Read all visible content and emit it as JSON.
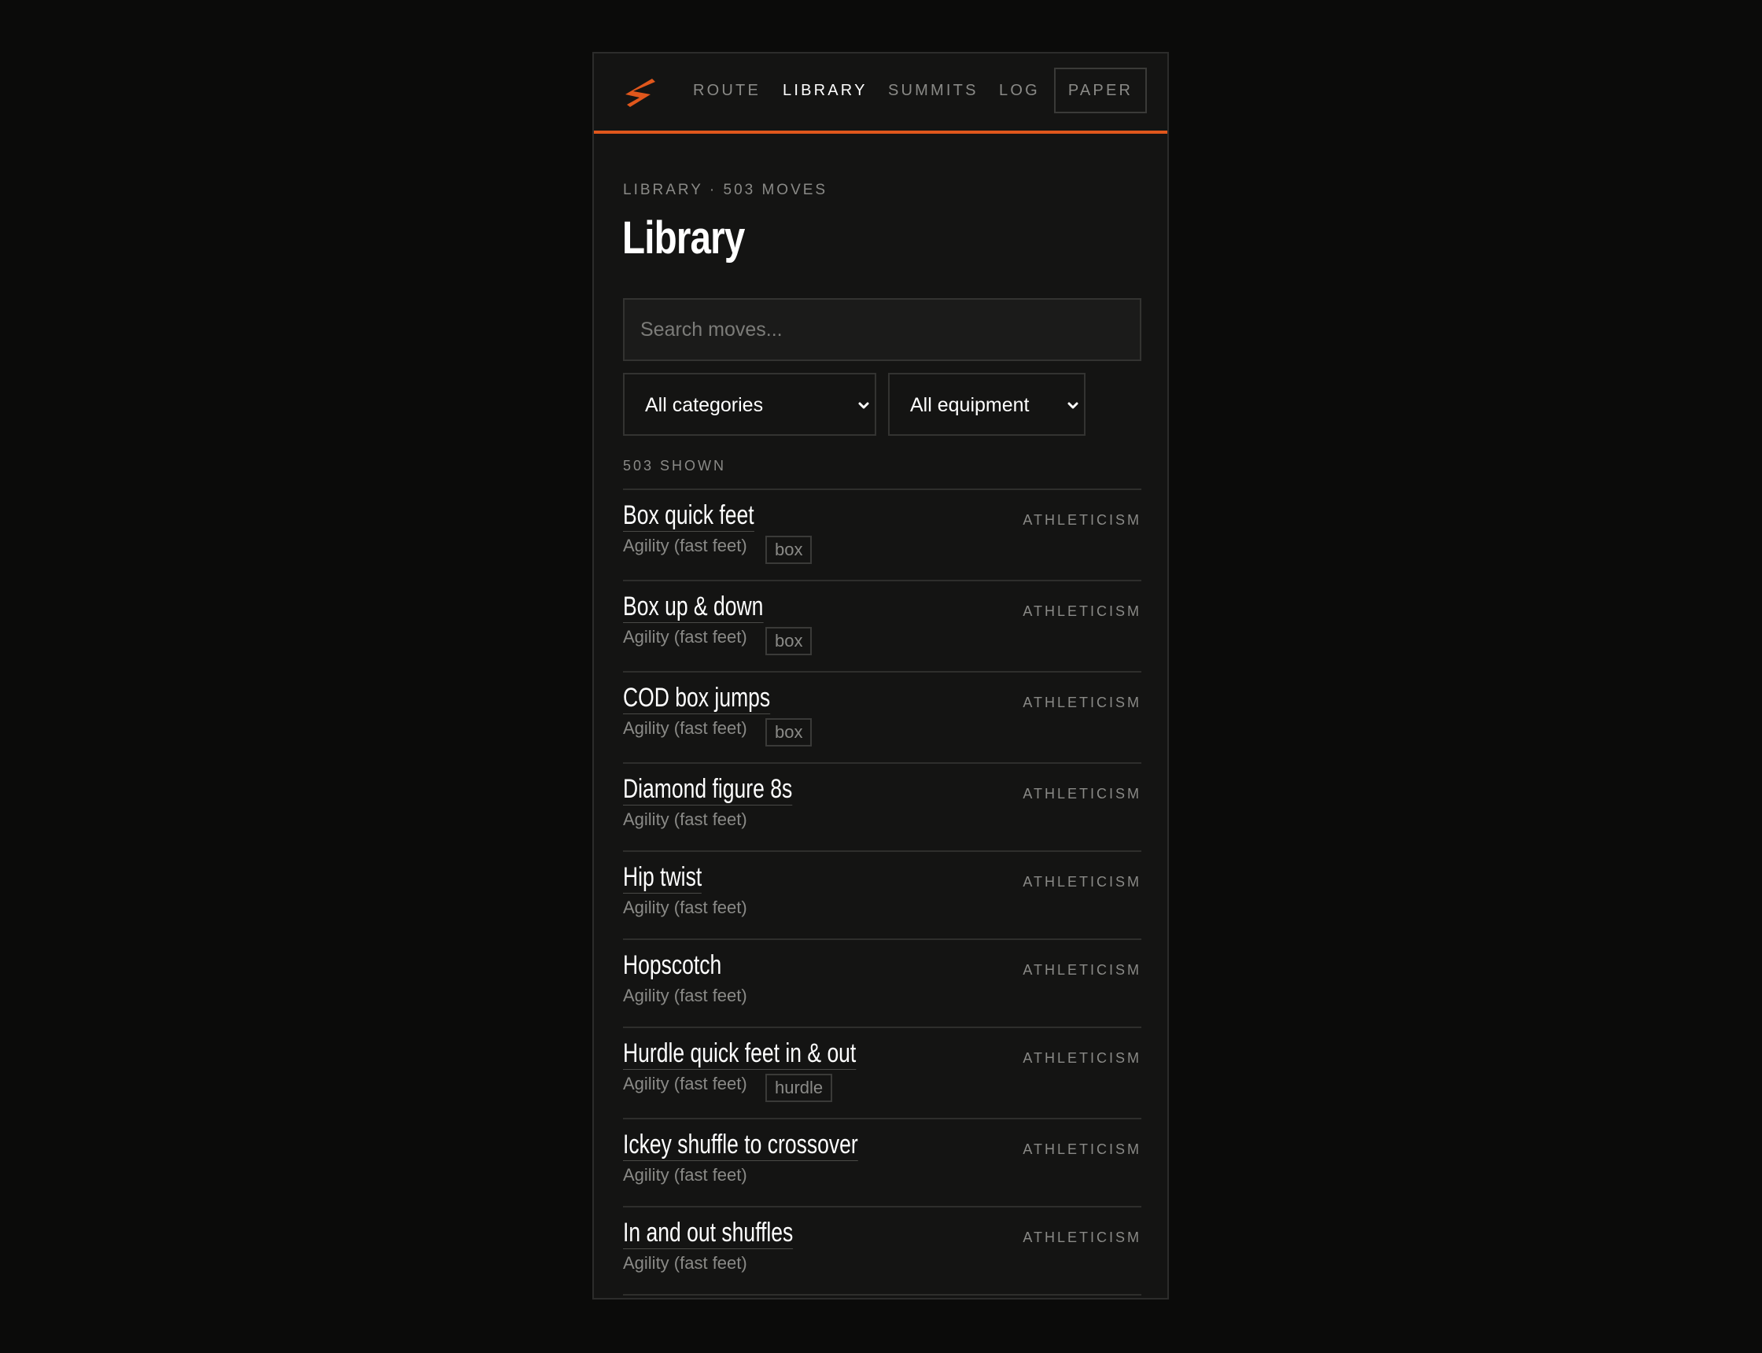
{
  "nav": {
    "logo": "lightning-bolt-logo",
    "links": [
      "ROUTE",
      "LIBRARY",
      "SUMMITS",
      "LOG"
    ],
    "active_link": "LIBRARY",
    "paper_button": "PAPER"
  },
  "header": {
    "eyebrow": "LIBRARY · 503 MOVES",
    "title": "Library"
  },
  "search": {
    "placeholder": "Search moves...",
    "value": ""
  },
  "filters": {
    "category": "All categories",
    "equipment": "All equipment"
  },
  "results": {
    "count_label": "503 SHOWN",
    "moves": [
      {
        "name": "Box quick feet",
        "subcategory": "Agility (fast feet)",
        "equipment": "box",
        "category": "ATHLETICISM"
      },
      {
        "name": "Box up & down",
        "subcategory": "Agility (fast feet)",
        "equipment": "box",
        "category": "ATHLETICISM"
      },
      {
        "name": "COD box jumps",
        "subcategory": "Agility (fast feet)",
        "equipment": "box",
        "category": "ATHLETICISM"
      },
      {
        "name": "Diamond figure 8s",
        "subcategory": "Agility (fast feet)",
        "equipment": "",
        "category": "ATHLETICISM"
      },
      {
        "name": "Hip twist",
        "subcategory": "Agility (fast feet)",
        "equipment": "",
        "category": "ATHLETICISM"
      },
      {
        "name": "Hopscotch",
        "subcategory": "Agility (fast feet)",
        "equipment": "",
        "category": "ATHLETICISM"
      },
      {
        "name": "Hurdle quick feet in & out",
        "subcategory": "Agility (fast feet)",
        "equipment": "hurdle",
        "category": "ATHLETICISM"
      },
      {
        "name": "Ickey shuffle to crossover",
        "subcategory": "Agility (fast feet)",
        "equipment": "",
        "category": "ATHLETICISM"
      },
      {
        "name": "In and out shuffles",
        "subcategory": "Agility (fast feet)",
        "equipment": "",
        "category": "ATHLETICISM"
      }
    ]
  },
  "colors": {
    "background": "#0b0b0a",
    "panel": "#141413",
    "accent": "#e0571c",
    "muted_text": "#8a8a87"
  }
}
